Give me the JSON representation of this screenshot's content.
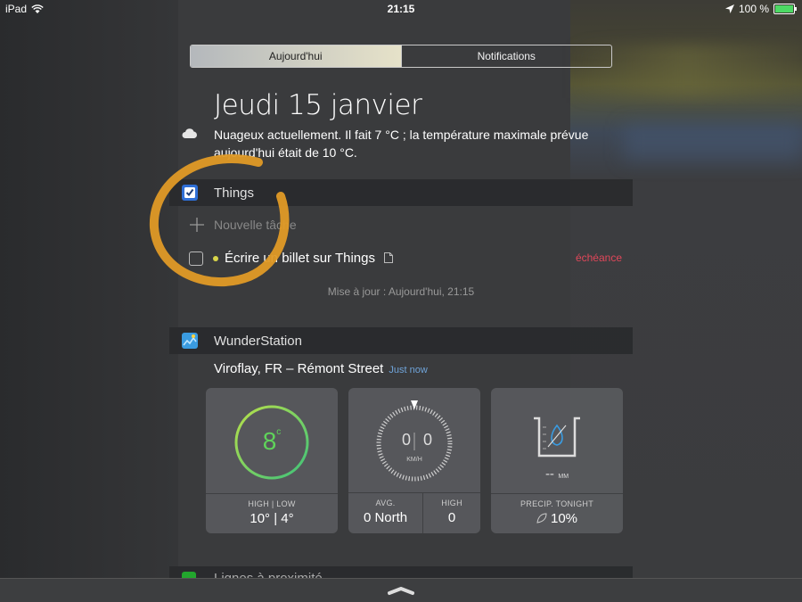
{
  "status_bar": {
    "device": "iPad",
    "time": "21:15",
    "battery": "100 %",
    "battery_level": 1.0
  },
  "segmented": {
    "today": "Aujourd'hui",
    "notifications": "Notifications"
  },
  "header": {
    "date": "Jeudi 15 janvier",
    "weather_summary": "Nuageux actuellement. Il fait 7 °C ; la température maximale prévue aujourd'hui était de 10 °C."
  },
  "things": {
    "title": "Things",
    "new_task": "Nouvelle tâche",
    "task": "Écrire un billet sur Things",
    "due": "échéance",
    "updated": "Mise à jour : Aujourd'hui, 21:15"
  },
  "wunder": {
    "title": "WunderStation",
    "location": "Viroflay, FR – Rémont Street",
    "freshness": "Just now",
    "temp": {
      "value": "8",
      "unit": "c",
      "label": "HIGH | LOW",
      "highlow": "10° | 4°"
    },
    "wind": {
      "speed_left": "0",
      "speed_right": "0",
      "unit": "KM/H",
      "avg_label": "AVG.",
      "avg_value": "0 North",
      "high_label": "HIGH",
      "high_value": "0"
    },
    "precip": {
      "value": "--",
      "unit": "MM",
      "label": "PRECIP. TONIGHT",
      "chance": "10%"
    }
  },
  "next_section": {
    "title": "Lignes à proximité"
  },
  "colors": {
    "accent_orange": "#e09a26",
    "due_red": "#e0475a",
    "temp_green": "#5fd35a",
    "link_blue": "#6fa3d8"
  }
}
